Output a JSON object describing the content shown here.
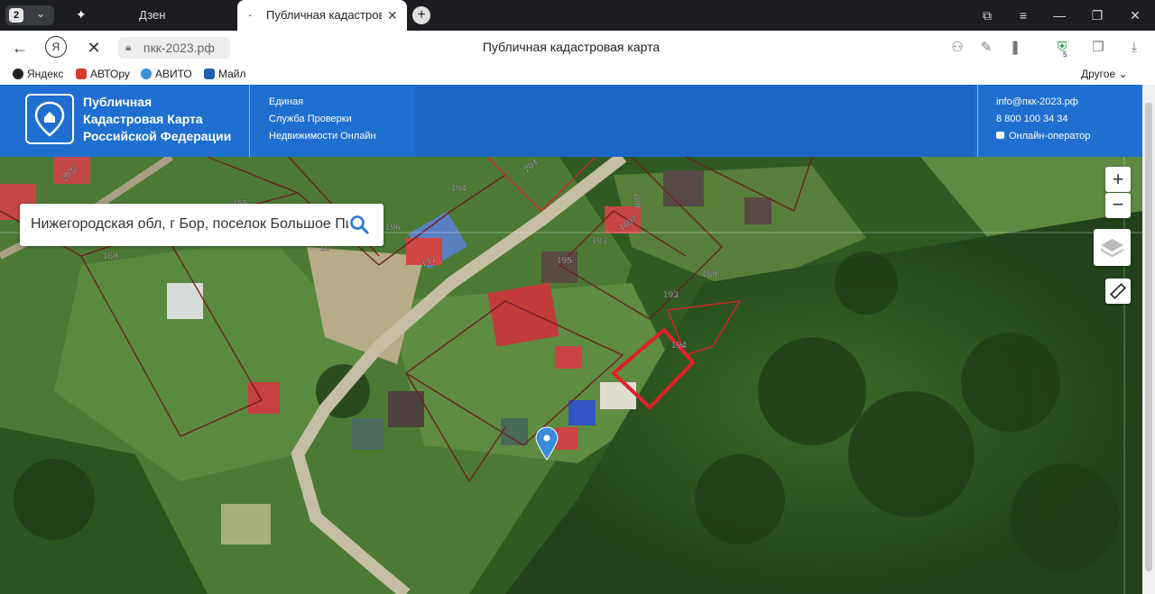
{
  "browser": {
    "tab_counter": "2",
    "tabs": [
      {
        "label": "Дзен"
      },
      {
        "label": "Публичная кадастровая карта"
      }
    ],
    "url": "пкк-2023.рф",
    "page_title": "Публичная кадастровая карта",
    "shield_badge": "5",
    "bookmarks": [
      "Яндекс",
      "АВТОру",
      "АВИТО",
      "Майл"
    ],
    "bookmarks_other": "Другое"
  },
  "site_header": {
    "brand_lines": [
      "Публичная",
      "Кадастровая Карта",
      "Российской Федерации"
    ],
    "subtitle_lines": [
      "Единая",
      "Служба Проверки",
      "Недвижимости Онлайн"
    ],
    "email": "info@пкк-2023.рф",
    "phone": "8 800 100 34 34",
    "operator": "Онлайн-оператор",
    "color": "#1e6fd0"
  },
  "map": {
    "search_value": "Нижегородская обл, г Бор, поселок Большое Пикино",
    "zoom_in": "+",
    "zoom_out": "−",
    "parcel_labels": [
      "2037",
      "204",
      "194",
      "189",
      "155",
      "196",
      "16",
      "1697",
      "193",
      "195",
      "147",
      "160",
      "189",
      "193",
      "194"
    ],
    "highlight_color": "#e0202a"
  }
}
